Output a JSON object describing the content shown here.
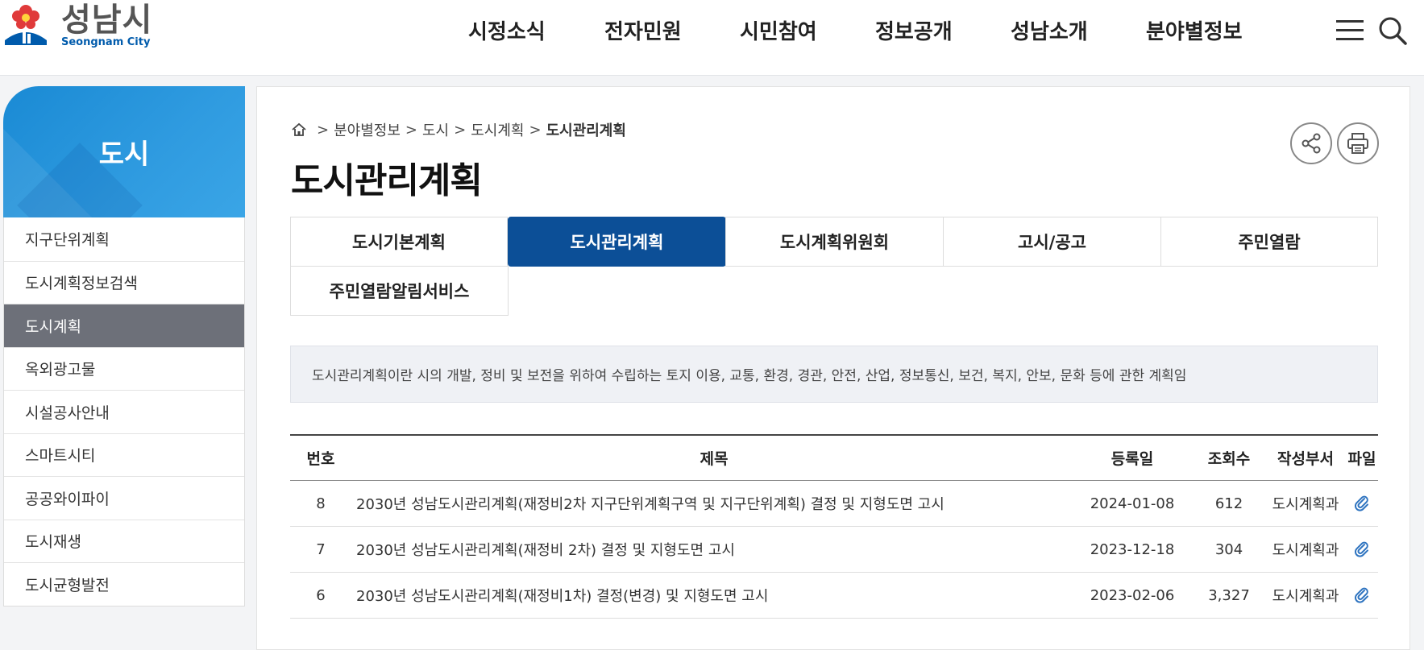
{
  "header": {
    "logo_ko": "성남시",
    "logo_en": "Seongnam City",
    "nav": [
      "시정소식",
      "전자민원",
      "시민참여",
      "정보공개",
      "성남소개",
      "분야별정보"
    ]
  },
  "sidebar": {
    "title": "도시",
    "items": [
      {
        "label": "지구단위계획"
      },
      {
        "label": "도시계획정보검색"
      },
      {
        "label": "도시계획"
      },
      {
        "label": "옥외광고물"
      },
      {
        "label": "시설공사안내"
      },
      {
        "label": "스마트시티"
      },
      {
        "label": "공공와이파이"
      },
      {
        "label": "도시재생"
      },
      {
        "label": "도시균형발전"
      }
    ],
    "active_index": 2
  },
  "breadcrumb": {
    "separator": ">",
    "items": [
      "분야별정보",
      "도시",
      "도시계획"
    ],
    "current": "도시관리계획"
  },
  "page": {
    "title": "도시관리계획",
    "description": "도시관리계획이란 시의 개발, 정비 및 보전을 위하여 수립하는 토지 이용, 교통, 환경, 경관, 안전, 산업, 정보통신, 보건, 복지, 안보, 문화 등에 관한 계획임"
  },
  "tabs": [
    {
      "label": "도시기본계획"
    },
    {
      "label": "도시관리계획"
    },
    {
      "label": "도시계획위원회"
    },
    {
      "label": "고시/공고"
    },
    {
      "label": "주민열람"
    },
    {
      "label": "주민열람알림서비스"
    }
  ],
  "table": {
    "headers": {
      "no": "번호",
      "title": "제목",
      "date": "등록일",
      "views": "조회수",
      "dept": "작성부서",
      "file": "파일"
    },
    "rows": [
      {
        "no": "8",
        "title": "2030년 성남도시관리계획(재정비2차 지구단위계획구역 및 지구단위계획) 결정 및 지형도면 고시",
        "date": "2024-01-08",
        "views": "612",
        "dept": "도시계획과"
      },
      {
        "no": "7",
        "title": "2030년 성남도시관리계획(재정비 2차) 결정 및 지형도면 고시",
        "date": "2023-12-18",
        "views": "304",
        "dept": "도시계획과"
      },
      {
        "no": "6",
        "title": "2030년 성남도시관리계획(재정비1차) 결정(변경) 및 지형도면 고시",
        "date": "2023-02-06",
        "views": "3,327",
        "dept": "도시계획과"
      }
    ]
  },
  "icons": {
    "home": "home-icon",
    "share": "share-icon",
    "print": "print-icon",
    "menu": "hamburger-menu-icon",
    "search": "search-icon",
    "attachment": "paperclip-icon"
  },
  "colors": {
    "accent": "#0c4f97",
    "sidebar_head": "#1a8ad4",
    "sidebar_active": "#6d7079",
    "logo_blue": "#005bac"
  }
}
